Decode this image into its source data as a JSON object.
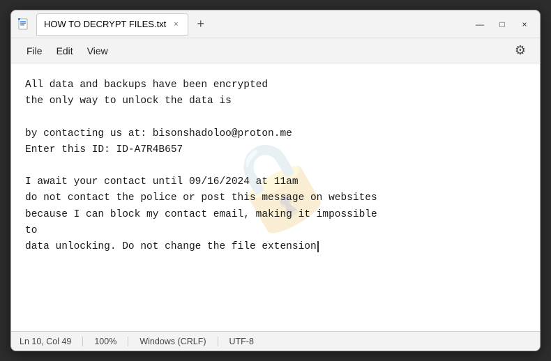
{
  "window": {
    "title": "HOW TO DECRYPT FILES.txt",
    "app_icon": "📄"
  },
  "tabs": {
    "active_tab_label": "HOW TO DECRYPT FILES.txt",
    "close_symbol": "×",
    "new_tab_symbol": "+"
  },
  "title_bar_controls": {
    "minimize": "—",
    "maximize": "□",
    "close": "×"
  },
  "menu": {
    "items": [
      "File",
      "Edit",
      "View"
    ],
    "gear_symbol": "⚙"
  },
  "content": {
    "lines": [
      "All data and backups have been encrypted",
      "the only way to unlock the data is",
      "",
      "by contacting us at: bisonshadoloo@proton.me",
      "Enter this ID: ID-A7R4B657",
      "",
      "I await your contact until 09/16/2024 at 11am",
      "do not contact the police or post this message on websites",
      "because I can block my contact email, making it impossible",
      "to",
      "data unlocking. Do not change the file extension"
    ],
    "watermark": "🔒"
  },
  "status_bar": {
    "position": "Ln 10, Col 49",
    "zoom": "100%",
    "line_ending": "Windows (CRLF)",
    "encoding": "UTF-8"
  }
}
